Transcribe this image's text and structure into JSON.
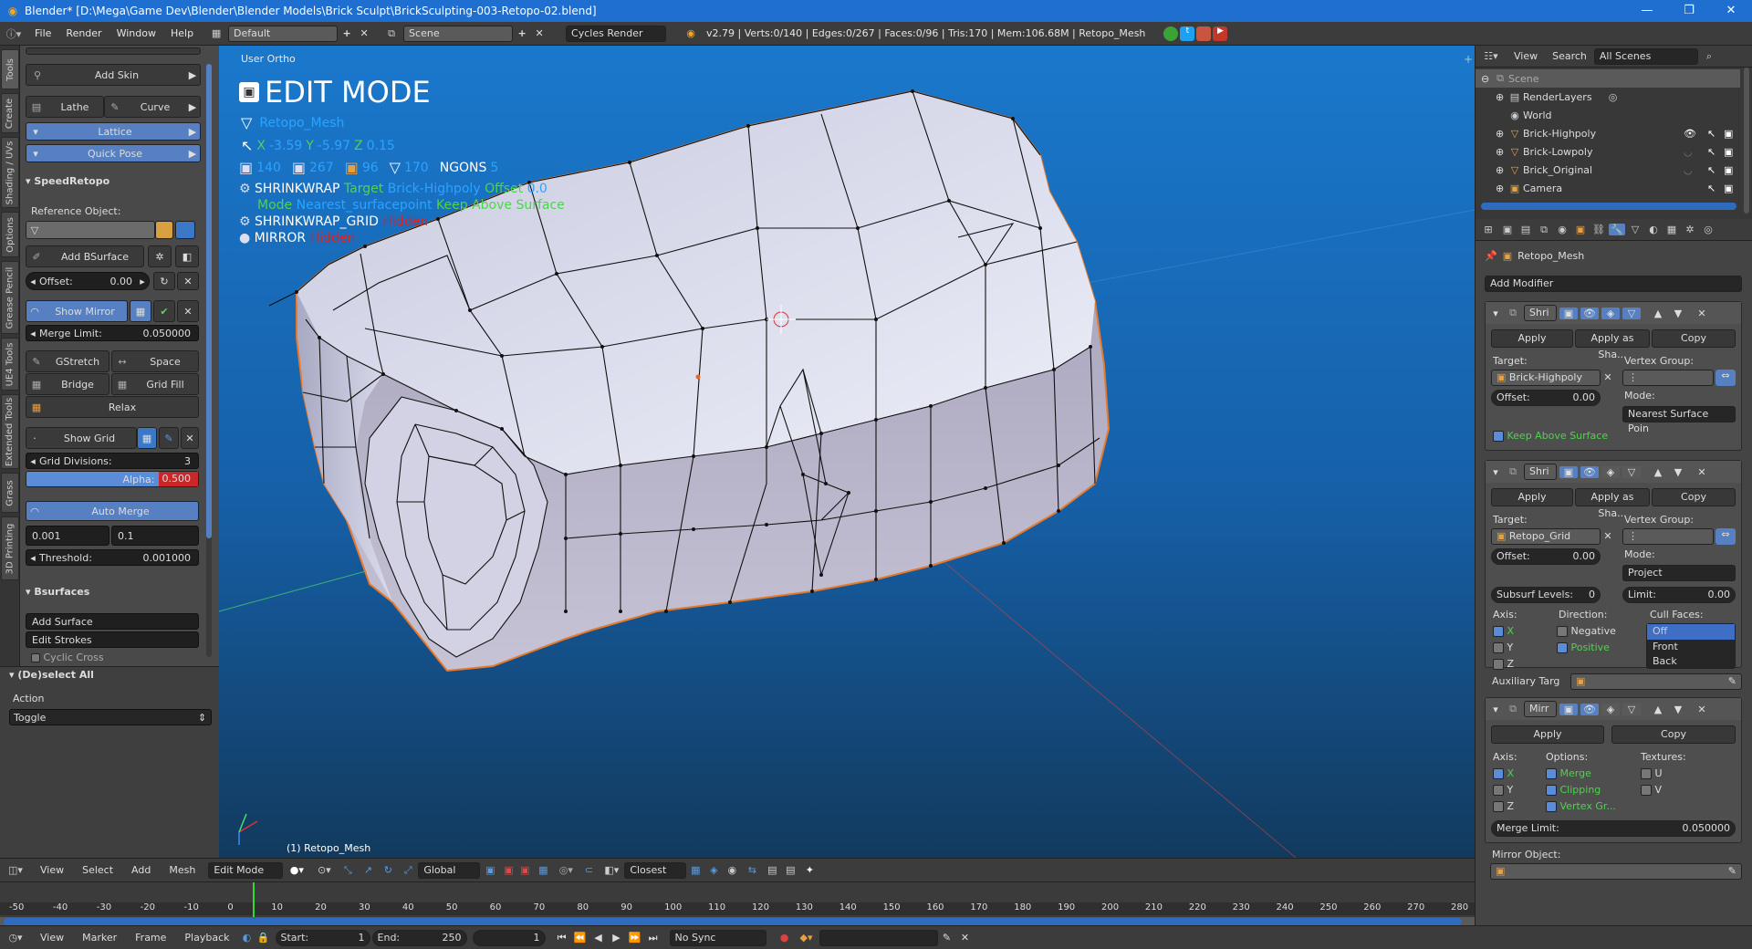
{
  "title_bar": {
    "text": "Blender* [D:\\Mega\\Game Dev\\Blender\\Blender Models\\Brick Sculpt\\BrickSculpting-003-Retopo-02.blend]",
    "minimize": "—",
    "restore": "❐",
    "close": "✕"
  },
  "menu": {
    "items": [
      "File",
      "Render",
      "Window",
      "Help"
    ],
    "screen_layout": "Default",
    "scene": "Scene",
    "render_engine": "Cycles Render",
    "stats": "v2.79 | Verts:0/140 | Edges:0/267 | Faces:0/96 | Tris:170 | Mem:106.68M | Retopo_Mesh"
  },
  "left_tabs": [
    "Tools",
    "Create",
    "Shading / UVs",
    "Options",
    "Grease Pencil",
    "UE4 Tools",
    "Extended Tools",
    "Grass",
    "3D Printing"
  ],
  "tool_panel": {
    "add_skin": "Add Skin",
    "lathe": "Lathe",
    "curve": "Curve",
    "lattice": "Lattice",
    "quick_pose": "Quick Pose",
    "speedretopo_header": "SpeedRetopo",
    "reference_object": "Reference Object:",
    "add_bsurface": "Add BSurface",
    "offset_label": "Offset:",
    "offset_value": "0.00",
    "show_mirror": "Show Mirror",
    "merge_limit_label": "Merge Limit:",
    "merge_limit_value": "0.050000",
    "gstretch": "GStretch",
    "space": "Space",
    "bridge": "Bridge",
    "grid_fill": "Grid Fill",
    "relax": "Relax",
    "show_grid": "Show Grid",
    "grid_divisions_label": "Grid Divisions:",
    "grid_divisions_value": "3",
    "alpha_label": "Alpha:",
    "alpha_value": "0.500",
    "auto_merge": "Auto Merge",
    "val_a": "0.001",
    "val_b": "0.1",
    "threshold_label": "Threshold:",
    "threshold_value": "0.001000",
    "bsurfaces_header": "Bsurfaces",
    "add_surface": "Add Surface",
    "edit_strokes": "Edit Strokes",
    "cyclic_cross": "Cyclic Cross"
  },
  "operator_panel": {
    "header": "(De)select All",
    "action_label": "Action",
    "action_value": "Toggle"
  },
  "viewport": {
    "view_name": "User Ortho",
    "mode_title": "EDIT MODE",
    "object_name": "Retopo_Mesh",
    "coords": {
      "x_label": "X",
      "x": "-3.59",
      "y_label": "Y",
      "y": "-5.97",
      "z_label": "Z",
      "z": "0.15"
    },
    "counts": {
      "verts": "140",
      "edges": "267",
      "faces": "96",
      "tris": "170",
      "ngons_label": "NGONS",
      "ngons": "5"
    },
    "mod1": {
      "name": "SHRINKWRAP",
      "target_label": "Target",
      "target": "Brick-Highpoly",
      "offset_label": "Offset",
      "offset": "0.0",
      "mode_label": "Mode",
      "mode": "Nearest_surfacepoint",
      "keep": "Keep Above Surface"
    },
    "mod2": {
      "name": "SHRINKWRAP_GRID",
      "state": "Hidden"
    },
    "mod3": {
      "name": "MIRROR",
      "state": "Hidden"
    },
    "object_info": "(1) Retopo_Mesh"
  },
  "view3d_header": {
    "view": "View",
    "select": "Select",
    "add": "Add",
    "mesh": "Mesh",
    "mode": "Edit Mode",
    "orientation": "Global",
    "snap": "Closest"
  },
  "timeline": {
    "ticks": [
      "-50",
      "-40",
      "-30",
      "-20",
      "-10",
      "0",
      "10",
      "20",
      "30",
      "40",
      "50",
      "60",
      "70",
      "80",
      "90",
      "100",
      "110",
      "120",
      "130",
      "140",
      "150",
      "160",
      "170",
      "180",
      "190",
      "200",
      "210",
      "220",
      "230",
      "240",
      "250",
      "260",
      "270",
      "280"
    ],
    "current_frame": 1
  },
  "timeline_header": {
    "view": "View",
    "marker": "Marker",
    "frame": "Frame",
    "playback": "Playback",
    "start_label": "Start:",
    "start": "1",
    "end_label": "End:",
    "end": "250",
    "current": "1",
    "sync": "No Sync"
  },
  "outliner": {
    "view": "View",
    "search": "Search",
    "filter": "All Scenes",
    "items": [
      {
        "name": "Scene",
        "level": 0
      },
      {
        "name": "RenderLayers",
        "level": 1
      },
      {
        "name": "World",
        "level": 1
      },
      {
        "name": "Brick-Highpoly",
        "level": 1
      },
      {
        "name": "Brick-Lowpoly",
        "level": 1
      },
      {
        "name": "Brick_Original",
        "level": 1
      },
      {
        "name": "Camera",
        "level": 1
      }
    ]
  },
  "properties": {
    "object": "Retopo_Mesh",
    "add_modifier": "Add Modifier",
    "modifiers": [
      {
        "short": "Shri",
        "apply": "Apply",
        "apply_shape": "Apply as Sha...",
        "copy": "Copy",
        "target_label": "Target:",
        "target": "Brick-Highpoly",
        "vgroup_label": "Vertex Group:",
        "offset_label": "Offset:",
        "offset": "0.00",
        "mode_label": "Mode:",
        "mode": "Nearest Surface Poin",
        "keep": "Keep Above Surface"
      },
      {
        "short": "Shri",
        "apply": "Apply",
        "apply_shape": "Apply as Sha...",
        "copy": "Copy",
        "target_label": "Target:",
        "target": "Retopo_Grid",
        "vgroup_label": "Vertex Group:",
        "offset_label": "Offset:",
        "offset": "0.00",
        "mode_label": "Mode:",
        "mode": "Project",
        "subsurf_label": "Subsurf Levels:",
        "subsurf": "0",
        "limit_label": "Limit:",
        "limit": "0.00",
        "axis_label": "Axis:",
        "direction_label": "Direction:",
        "cull_label": "Cull Faces:",
        "axes": [
          "X",
          "Y",
          "Z"
        ],
        "negative": "Negative",
        "positive": "Positive",
        "cull_options": [
          "Off",
          "Front",
          "Back"
        ],
        "aux_label": "Auxiliary Targ"
      },
      {
        "short": "Mirr",
        "apply": "Apply",
        "copy": "Copy",
        "axis_label": "Axis:",
        "options_label": "Options:",
        "textures_label": "Textures:",
        "axes": [
          "X",
          "Y",
          "Z"
        ],
        "options": [
          "Merge",
          "Clipping",
          "Vertex Gr..."
        ],
        "textures": [
          "U",
          "V"
        ],
        "merge_limit_label": "Merge Limit:",
        "merge_limit": "0.050000",
        "mirror_object_label": "Mirror Object:"
      }
    ]
  },
  "colors": {
    "title_blue": "#1f6fd0",
    "active_blue": "#5680c2",
    "green_text": "#4fd24f",
    "red_text": "#e02020",
    "cyan_text": "#2ba3ff",
    "mesh_edge": "#101010",
    "mesh_outline": "#e77a2a"
  }
}
